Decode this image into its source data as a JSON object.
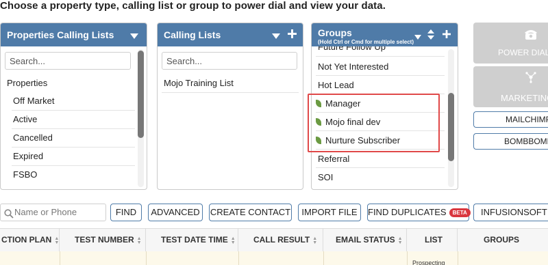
{
  "heading": "Choose a property type, calling list or group to power dial and view your data.",
  "properties_panel": {
    "title": "Properties Calling Lists",
    "search_placeholder": "Search...",
    "group_label": "Properties",
    "items": [
      "Off Market",
      "Active",
      "Cancelled",
      "Expired",
      "FSBO"
    ]
  },
  "calling_panel": {
    "title": "Calling Lists",
    "search_placeholder": "Search...",
    "items": [
      "Mojo Training List"
    ]
  },
  "groups_panel": {
    "title": "Groups",
    "subtitle": "(Hold Ctrl or Cmd for multiple select)",
    "partial_item": "Future Follow Up",
    "items": [
      "Not Yet Interested",
      "Hot Lead",
      "Manager",
      "Mojo final dev",
      "Nurture Subscriber",
      "Referral",
      "SOI"
    ],
    "highlighted_items": [
      "Manager",
      "Mojo final dev",
      "Nurture Subscriber"
    ],
    "highlight_color": "#e04848"
  },
  "side_buttons": {
    "power_dial": "POWER DIAL",
    "marketing": "MARKETING",
    "mailchimp": "MAILCHIMP",
    "bombbomb": "BOMBBOMB"
  },
  "toolbar": {
    "name_placeholder": "Name or Phone",
    "find": "FIND",
    "advanced": "ADVANCED",
    "create_contact": "CREATE CONTACT",
    "import_file": "IMPORT FILE",
    "find_duplicates": "FIND DUPLICATES",
    "beta_badge": "BETA",
    "infusionsoft": "INFUSIONSOFT"
  },
  "table": {
    "columns": [
      "CTION PLAN",
      "TEST NUMBER",
      "TEST DATE TIME",
      "CALL RESULT",
      "EMAIL STATUS",
      "LIST",
      "GROUPS"
    ],
    "first_row_list_partial": "Prospecting"
  },
  "colors": {
    "header_blue": "#4f7ba8",
    "beta_red": "#d9363e",
    "row_highlight": "#fdf9ea"
  }
}
